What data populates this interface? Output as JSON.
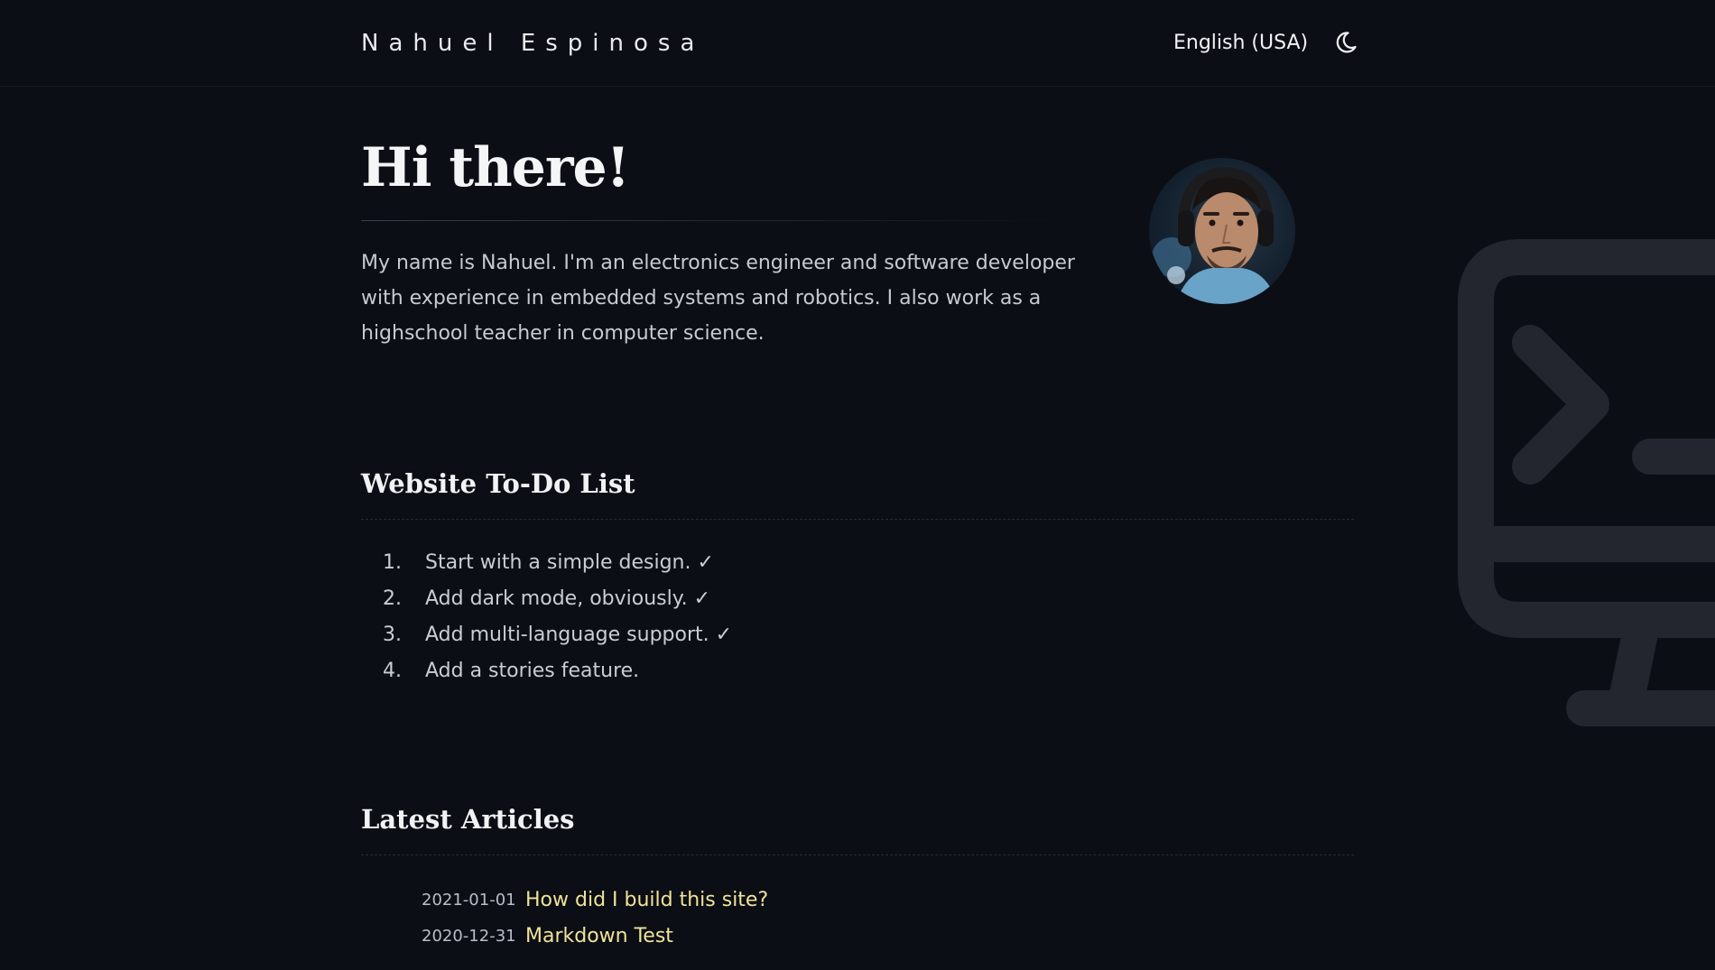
{
  "header": {
    "site_title": "Nahuel Espinosa",
    "language": "English (USA)",
    "theme_icon": "moon-icon"
  },
  "hero": {
    "title": "Hi there!",
    "intro": "My name is Nahuel. I'm an electronics engineer and software developer with experience in embedded systems and robotics. I also work as a highschool teacher in computer science.",
    "avatar_icon": "profile-photo"
  },
  "todo": {
    "title": "Website To-Do List",
    "items": [
      {
        "num": "1.",
        "text": "Start with a simple design. ✓"
      },
      {
        "num": "2.",
        "text": "Add dark mode, obviously. ✓"
      },
      {
        "num": "3.",
        "text": "Add multi-language support. ✓"
      },
      {
        "num": "4.",
        "text": "Add a stories feature."
      }
    ]
  },
  "articles": {
    "title": "Latest Articles",
    "items": [
      {
        "date": "2021-01-01",
        "title": "How did I build this site?"
      },
      {
        "date": "2020-12-31",
        "title": "Markdown Test"
      }
    ]
  },
  "colors": {
    "background": "#0c0e15",
    "accent_link": "#efe39a",
    "decor_icon": "#23262e"
  }
}
